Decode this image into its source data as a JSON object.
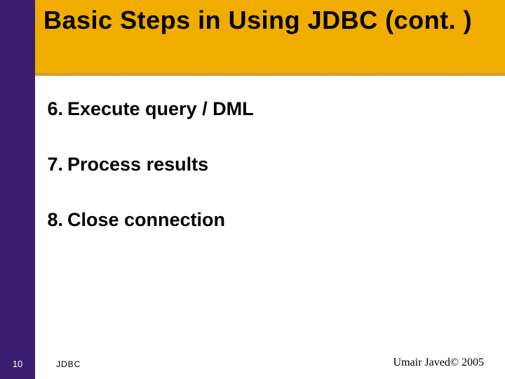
{
  "title": "Basic Steps in Using JDBC (cont. )",
  "steps": [
    {
      "num": "6.",
      "text": "Execute query / DML"
    },
    {
      "num": "7.",
      "text": "Process results"
    },
    {
      "num": "8.",
      "text": "Close connection"
    }
  ],
  "footer": {
    "page_number": "10",
    "topic": "JDBC",
    "author": "Umair Javed© 2005"
  }
}
